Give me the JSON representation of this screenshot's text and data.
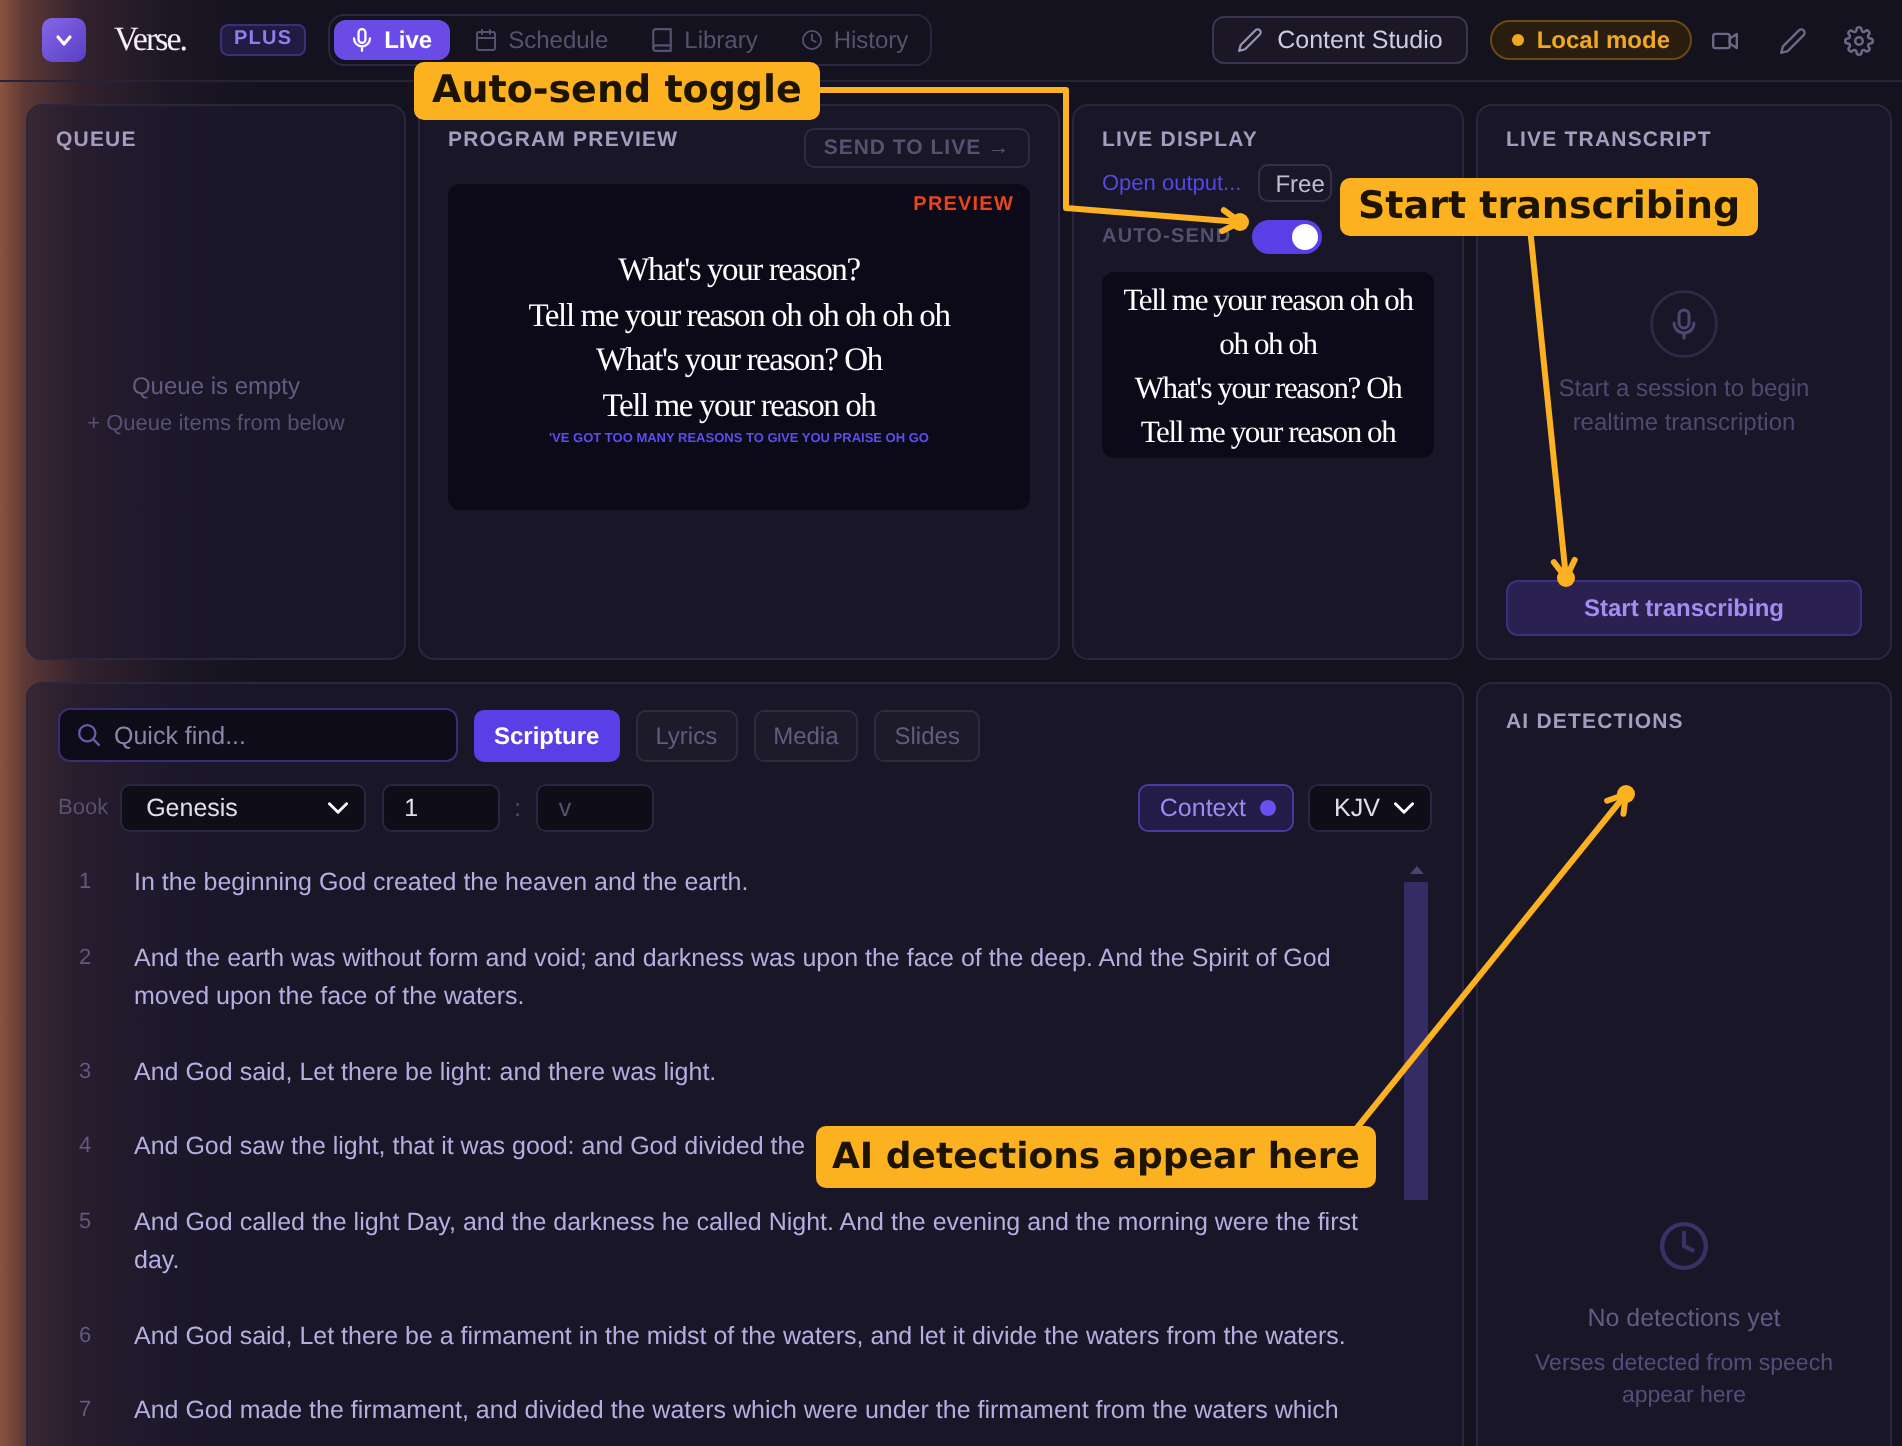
{
  "top_bar": {
    "brand": "Verse.",
    "plan_badge": "PLUS",
    "nav_tabs": [
      {
        "label": "Live",
        "selected": true
      },
      {
        "label": "Schedule",
        "selected": false
      },
      {
        "label": "Library",
        "selected": false
      },
      {
        "label": "History",
        "selected": false
      }
    ],
    "studio_button": "Content Studio",
    "mode_badge": "Local mode"
  },
  "queue": {
    "title": "QUEUE",
    "empty_title": "Queue is empty",
    "empty_hint": "+ Queue items from below"
  },
  "program_preview": {
    "title": "PROGRAM PREVIEW",
    "send_button": "SEND TO LIVE →",
    "badge": "PREVIEW",
    "lines": [
      "What's your reason?",
      "Tell me your reason oh oh oh oh oh",
      "What's your reason? Oh",
      "Tell me your reason oh"
    ],
    "ticker": "'VE GOT TOO MANY REASONS TO GIVE YOU PRAISE OH GO"
  },
  "live_display": {
    "title": "LIVE DISPLAY",
    "output_link": "Open output...",
    "button": "Free",
    "auto_send": {
      "label": "AUTO-SEND",
      "on": true
    },
    "lines": [
      "Tell me your reason oh oh",
      "oh oh oh",
      "What's your reason? Oh",
      "Tell me your reason oh"
    ]
  },
  "live_transcript": {
    "title": "LIVE TRANSCRIPT",
    "hint": "Start a session to begin realtime transcription",
    "start_button": "Start transcribing"
  },
  "library": {
    "search": {
      "placeholder": "Quick find..."
    },
    "tabs": [
      {
        "label": "Scripture",
        "selected": true
      },
      {
        "label": "Lyrics",
        "selected": false
      },
      {
        "label": "Media",
        "selected": false
      },
      {
        "label": "Slides",
        "selected": false
      }
    ],
    "book_label": "Book",
    "book": "Genesis",
    "chapter": "1",
    "separator": ":",
    "verse_field": {
      "placeholder": "v"
    },
    "context": {
      "label": "Context",
      "on": true
    },
    "translation": "KJV",
    "verses": [
      {
        "number": "1",
        "text": "In the beginning God created the heaven and the earth."
      },
      {
        "number": "2",
        "text": "And the earth was without form and void; and darkness was upon the face of the deep. And the Spirit of God moved upon the face of the waters."
      },
      {
        "number": "3",
        "text": "And God said, Let there be light: and there was light."
      },
      {
        "number": "4",
        "text": "And God saw the light, that it was good: and God divided the"
      },
      {
        "number": "5",
        "text": "And God called the light Day, and the darkness he called Night. And the evening and the morning were the first day."
      },
      {
        "number": "6",
        "text": "And God said, Let there be a firmament in the midst of the waters, and let it divide the waters from the waters."
      },
      {
        "number": "7",
        "text": "And God made the firmament, and divided the waters which were under the firmament from the waters which"
      }
    ]
  },
  "ai_detections": {
    "title": "AI DETECTIONS",
    "empty_title": "No detections yet",
    "empty_hint": "Verses detected from speech appear here"
  },
  "annotations": [
    {
      "label": "Auto-send toggle"
    },
    {
      "label": "Start transcribing"
    },
    {
      "label": "AI detections appear here"
    }
  ]
}
